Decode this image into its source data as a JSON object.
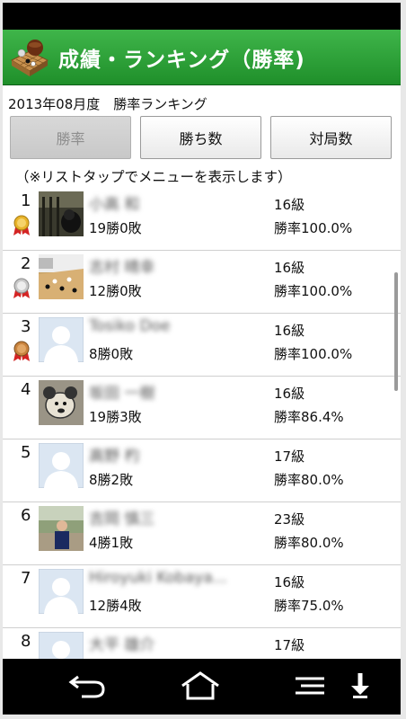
{
  "app": {
    "title": "成績・ランキング（勝率)"
  },
  "subtitle": "2013年08月度　勝率ランキング",
  "tabs": [
    {
      "label": "勝率",
      "active": true
    },
    {
      "label": "勝ち数",
      "active": false
    },
    {
      "label": "対局数",
      "active": false
    }
  ],
  "hint": "（※リストタップでメニューを表示します）",
  "ranking": [
    {
      "rank": "1",
      "name": "小高 和",
      "record": "19勝0敗",
      "class": "16級",
      "rate": "勝率100.0%",
      "medal": "gold"
    },
    {
      "rank": "2",
      "name": "志村 晴幸",
      "record": "12勝0敗",
      "class": "16級",
      "rate": "勝率100.0%",
      "medal": "silver"
    },
    {
      "rank": "3",
      "name": "Tosiko Doe",
      "record": "8勝0敗",
      "class": "16級",
      "rate": "勝率100.0%",
      "medal": "bronze"
    },
    {
      "rank": "4",
      "name": "坂田 一樹",
      "record": "19勝3敗",
      "class": "16級",
      "rate": "勝率86.4%"
    },
    {
      "rank": "5",
      "name": "高野 杓",
      "record": "8勝2敗",
      "class": "17級",
      "rate": "勝率80.0%"
    },
    {
      "rank": "6",
      "name": "吉岡 慎三",
      "record": "4勝1敗",
      "class": "23級",
      "rate": "勝率80.0%"
    },
    {
      "rank": "7",
      "name": "Hiroyuki Kobaya...",
      "record": "12勝4敗",
      "class": "16級",
      "rate": "勝率75.0%"
    },
    {
      "rank": "8",
      "name": "大平 雄介",
      "record": "",
      "class": "17級",
      "rate": ""
    }
  ],
  "colors": {
    "appbar": "#2aa336",
    "gold": "#e8b32a",
    "silver": "#c8c8c8",
    "bronze": "#c9843f",
    "ribbon": "#d42424"
  },
  "icons": {
    "back": "back-arrow-icon",
    "home": "home-icon",
    "menu": "menu-icon",
    "download": "download-arrow-icon",
    "app": "go-board-icon"
  }
}
